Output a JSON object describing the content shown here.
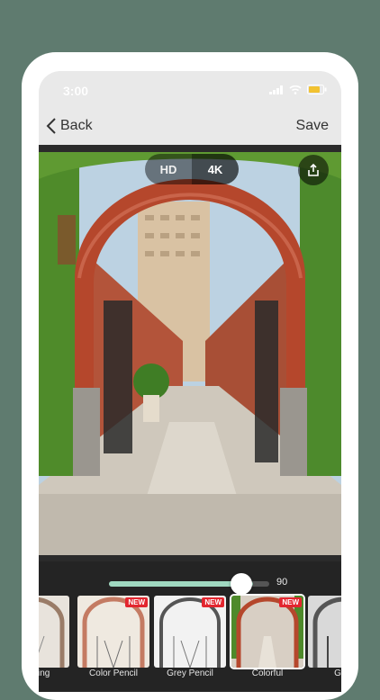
{
  "status_bar": {
    "time": "3:00"
  },
  "navbar": {
    "back_label": "Back",
    "save_label": "Save"
  },
  "quality": {
    "options": [
      "HD",
      "4K"
    ],
    "selected": "4K"
  },
  "slider": {
    "value": 90,
    "value_label": "90",
    "min": 0,
    "max": 100
  },
  "filters": [
    {
      "label": "Drawing",
      "badge": ""
    },
    {
      "label": "Color Pencil",
      "badge": "NEW"
    },
    {
      "label": "Grey Pencil",
      "badge": "NEW"
    },
    {
      "label": "Colorful",
      "badge": "NEW"
    },
    {
      "label": "Grey",
      "badge": ""
    }
  ],
  "colors": {
    "background": "#5f7b6f",
    "accent": "#9fd8c0",
    "badge": "#e3262f",
    "panel": "#242424"
  }
}
